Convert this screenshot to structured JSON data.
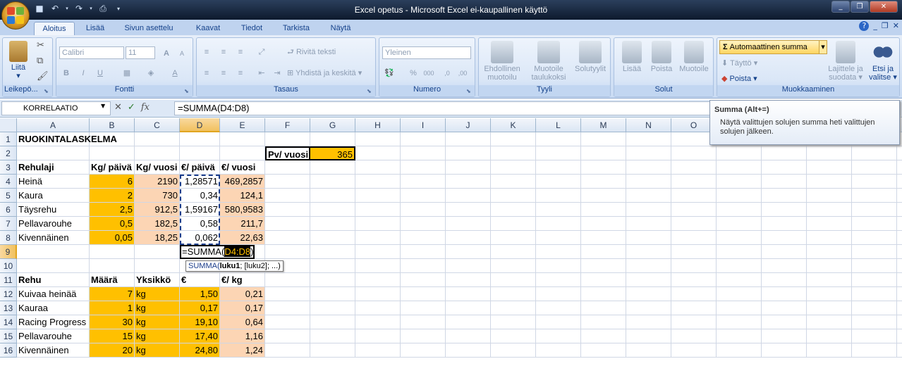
{
  "window": {
    "title": "Excel opetus - Microsoft Excel ei-kaupallinen käyttö"
  },
  "tabs": [
    "Aloitus",
    "Lisää",
    "Sivun asettelu",
    "Kaavat",
    "Tiedot",
    "Tarkista",
    "Näytä"
  ],
  "ribbon": {
    "clipboard": {
      "group": "Leikepö...",
      "paste": "Liitä"
    },
    "font": {
      "group": "Fontti",
      "name": "Calibri",
      "size": "11",
      "bold": "B",
      "italic": "I",
      "underline": "U",
      "grow": "A",
      "shrink": "A",
      "color": "A"
    },
    "alignment": {
      "group": "Tasaus",
      "wrap": "Rivitä teksti",
      "merge": "Yhdistä ja keskitä"
    },
    "number": {
      "group": "Numero",
      "format": "Yleinen",
      "percent": "%",
      "thousands": "000",
      "inc": ",0",
      "dec": ",00"
    },
    "styles": {
      "group": "Tyyli",
      "conditional": "Ehdollinen muotoilu",
      "table": "Muotoile taulukoksi",
      "cell": "Solutyylit"
    },
    "cells": {
      "group": "Solut",
      "insert": "Lisää",
      "delete": "Poista",
      "format": "Muotoile"
    },
    "editing": {
      "group": "Muokkaaminen",
      "autosum": "Automaattinen summa",
      "fill": "Täyttö",
      "clear": "Poista",
      "sort": "Lajittele ja suodata",
      "find": "Etsi ja valitse"
    }
  },
  "formula_bar": {
    "name_box": "KORRELAATIO",
    "formula": "=SUMMA(D4:D8)"
  },
  "tooltip": {
    "title": "Summa (Alt+=)",
    "desc": "Näytä valittujen solujen summa heti valittujen solujen jälkeen."
  },
  "columns": [
    "A",
    "B",
    "C",
    "D",
    "E",
    "F",
    "G",
    "H",
    "I",
    "J",
    "K",
    "L",
    "M",
    "N",
    "O"
  ],
  "rows": [
    "1",
    "2",
    "3",
    "4",
    "5",
    "6",
    "7",
    "8",
    "9",
    "10",
    "11",
    "12",
    "13",
    "14",
    "15",
    "16"
  ],
  "cells": {
    "A1": "RUOKINTALASKELMA",
    "F2": "Pv/ vuosi",
    "G2": "365",
    "A3": "Rehulaji",
    "B3": "Kg/ päivä",
    "C3": "Kg/ vuosi",
    "D3": "€/ päivä",
    "E3": "€/ vuosi",
    "A4": "Heinä",
    "B4": "6",
    "C4": "2190",
    "D4": "1,28571",
    "E4": "469,2857",
    "A5": "Kaura",
    "B5": "2",
    "C5": "730",
    "D5": "0,34",
    "E5": "124,1",
    "A6": "Täysrehu",
    "B6": "2,5",
    "C6": "912,5",
    "D6": "1,59167",
    "E6": "580,9583",
    "A7": "Pellavarouhe",
    "B7": "0,5",
    "C7": "182,5",
    "D7": "0,58",
    "E7": "211,7",
    "A8": "Kivennäinen",
    "B8": "0,05",
    "C8": "18,25",
    "D8": "0,062",
    "E8": "22,63",
    "A11": "Rehu",
    "B11": "Määrä",
    "C11": "Yksikkö",
    "D11": "€",
    "E11": "€/ kg",
    "A12": "Kuivaa heinää",
    "B12": "7",
    "C12": "kg",
    "D12": "1,50",
    "E12": "0,21",
    "A13": "Kauraa",
    "B13": "1",
    "C13": "kg",
    "D13": "0,17",
    "E13": "0,17",
    "A14": "Racing Progress",
    "B14": "30",
    "C14": "kg",
    "D14": "19,10",
    "E14": "0,64",
    "A15": "Pellavarouhe",
    "B15": "15",
    "C15": "kg",
    "D15": "17,40",
    "E15": "1,16",
    "A16": "Kivennäinen",
    "B16": "20",
    "C16": "kg",
    "D16": "24,80",
    "E16": "1,24"
  },
  "edit": {
    "prefix": "=SUMMA(",
    "ref": "D4:D8",
    "suffix": ")",
    "hint_fn": "SUMMA(",
    "hint_arg1": "luku1",
    "hint_rest": "; [luku2]; ...)"
  }
}
